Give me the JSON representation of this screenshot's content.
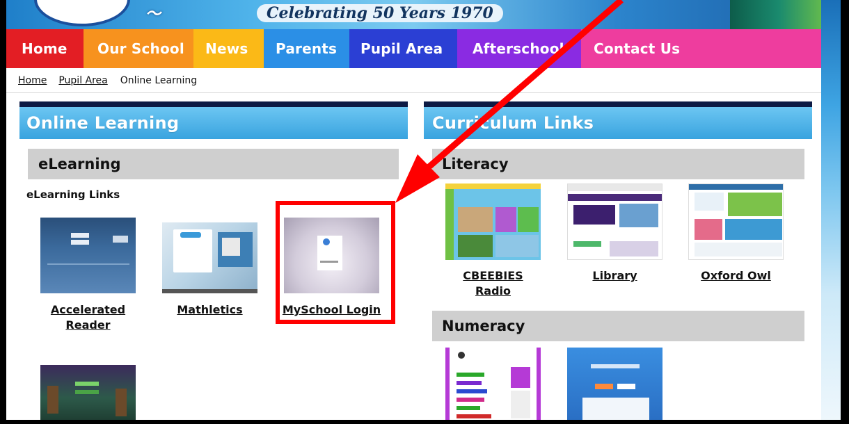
{
  "banner": {
    "tagline": "Celebrating 50 Years 1970"
  },
  "nav": {
    "items": [
      {
        "label": "Home",
        "color": "#e31e24"
      },
      {
        "label": "Our School",
        "color": "#f7921e"
      },
      {
        "label": "News",
        "color": "#fbb917"
      },
      {
        "label": "Parents",
        "color": "#2b8fe6"
      },
      {
        "label": "Pupil Area",
        "color": "#2b3fd4"
      },
      {
        "label": "Afterschool",
        "color": "#8a2be2"
      },
      {
        "label": "Contact Us",
        "color": "#ee3d9e"
      }
    ]
  },
  "breadcrumb": {
    "items": [
      "Home",
      "Pupil Area",
      "Online Learning"
    ]
  },
  "left": {
    "title": "Online Learning",
    "subheading": "eLearning",
    "links_label": "eLearning Links",
    "links": [
      {
        "label_line1": "Accelerated",
        "label_line2": "Reader"
      },
      {
        "label_line1": "Mathletics"
      },
      {
        "label_line1": "MySchool Login"
      }
    ]
  },
  "right": {
    "title": "Curriculum Links",
    "literacy": {
      "heading": "Literacy",
      "links": [
        {
          "label": "CBEEBIES Radio"
        },
        {
          "label": "Library"
        },
        {
          "label": "Oxford Owl"
        }
      ]
    },
    "numeracy": {
      "heading": "Numeracy"
    }
  },
  "colors": {
    "accent_blue": "#39a3df",
    "dark_bar": "#0d1a44",
    "callout_red": "#ff0000"
  }
}
